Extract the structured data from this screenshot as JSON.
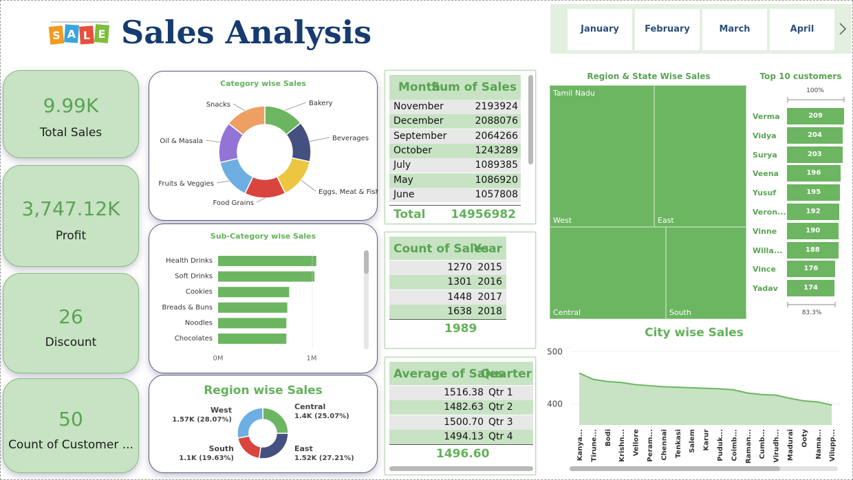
{
  "header": {
    "logo_text": "SALE",
    "title": "Sales Analysis"
  },
  "kpis": [
    {
      "value": "9.99K",
      "label": "Total Sales"
    },
    {
      "value": "3,747.12K",
      "label": "Profit"
    },
    {
      "value": "26",
      "label": "Discount"
    },
    {
      "value": "50",
      "label": "Count of Customer ..."
    }
  ],
  "category_chart": {
    "title": "Category wise Sales",
    "slices": [
      {
        "name": "Bakery",
        "color": "#6cb561"
      },
      {
        "name": "Beverages",
        "color": "#44507f"
      },
      {
        "name": "Eggs, Meat & Fish",
        "color": "#edc641"
      },
      {
        "name": "Food Grains",
        "color": "#d9443e"
      },
      {
        "name": "Fruits & Veggies",
        "color": "#6daee3"
      },
      {
        "name": "Oil & Masala",
        "color": "#9374d6"
      },
      {
        "name": "Snacks",
        "color": "#ee9f62"
      }
    ]
  },
  "subcategory_chart": {
    "title": "Sub-Category wise Sales",
    "categories": [
      "Health Drinks",
      "Soft Drinks",
      "Cookies",
      "Breads & Buns",
      "Noodles",
      "Chocolates"
    ],
    "tick_labels": [
      "0M",
      "1M"
    ],
    "bar_color": "#6cb561"
  },
  "region_chart": {
    "title": "Region wise Sales",
    "slices": [
      {
        "name": "Central",
        "label": "1.4K (25.07%)",
        "color": "#6cb561"
      },
      {
        "name": "East",
        "label": "1.52K (27.21%)",
        "color": "#44507f"
      },
      {
        "name": "South",
        "label": "1.1K (19.63%)",
        "color": "#d9443e"
      },
      {
        "name": "West",
        "label": "1.57K (28.07%)",
        "color": "#6daee3"
      }
    ]
  },
  "month_table": {
    "headers": [
      "Month",
      "Sum of Sales"
    ],
    "rows": [
      [
        "November",
        "2193924"
      ],
      [
        "December",
        "2088076"
      ],
      [
        "September",
        "2064266"
      ],
      [
        "October",
        "1243289"
      ],
      [
        "July",
        "1089385"
      ],
      [
        "May",
        "1086920"
      ],
      [
        "June",
        "1057808"
      ]
    ],
    "total_label": "Total",
    "total_value": "14956982"
  },
  "year_table": {
    "headers": [
      "Count of Sales",
      "Year"
    ],
    "rows": [
      [
        "1270",
        "2015"
      ],
      [
        "1301",
        "2016"
      ],
      [
        "1448",
        "2017"
      ],
      [
        "1638",
        "2018"
      ]
    ],
    "total_value": "1989"
  },
  "quarter_table": {
    "headers": [
      "Average of Sales",
      "Quarter"
    ],
    "rows": [
      [
        "1516.38",
        "Qtr 1"
      ],
      [
        "1482.63",
        "Qtr 2"
      ],
      [
        "1500.70",
        "Qtr 3"
      ],
      [
        "1494.13",
        "Qtr 4"
      ]
    ],
    "total_value": "1496.60"
  },
  "month_slicer": {
    "items": [
      "January",
      "February",
      "March",
      "April"
    ],
    "next_icon": "chevron-right-icon"
  },
  "treemap": {
    "title": "Region & State Wise Sales",
    "state_label": "Tamil Nadu",
    "regions": [
      "West",
      "East",
      "Central",
      "South"
    ],
    "color": "#6cb561"
  },
  "top_customers": {
    "title": "Top 10 customers",
    "top_percent": "100%",
    "bottom_percent": "83.3%",
    "customers": [
      {
        "name": "Verma",
        "value": 209
      },
      {
        "name": "Vidya",
        "value": 204
      },
      {
        "name": "Surya",
        "value": 203
      },
      {
        "name": "Veena",
        "value": 196
      },
      {
        "name": "Yusuf",
        "value": 195
      },
      {
        "name": "Veron...",
        "value": 192
      },
      {
        "name": "Vinne",
        "value": 190
      },
      {
        "name": "Willa...",
        "value": 188
      },
      {
        "name": "Vince",
        "value": 176
      },
      {
        "name": "Yadav",
        "value": 174
      }
    ]
  },
  "city_chart": {
    "title": "City wise Sales",
    "y_ticks": [
      "500",
      "400"
    ]
  },
  "chart_data": [
    {
      "type": "pie",
      "title": "Category wise Sales",
      "categories": [
        "Bakery",
        "Beverages",
        "Eggs, Meat & Fish",
        "Food Grains",
        "Fruits & Veggies",
        "Oil & Masala",
        "Snacks"
      ],
      "values": [
        14.2,
        14.2,
        14.3,
        14.4,
        14.2,
        14.3,
        14.4
      ]
    },
    {
      "type": "bar",
      "orientation": "horizontal",
      "title": "Sub-Category wise Sales",
      "categories": [
        "Health Drinks",
        "Soft Drinks",
        "Cookies",
        "Breads & Buns",
        "Noodles",
        "Chocolates"
      ],
      "values": [
        1.05,
        1.03,
        0.76,
        0.74,
        0.73,
        0.73
      ],
      "xlim": [
        0,
        1.25
      ],
      "x_ticks": [
        "0M",
        "1M"
      ]
    },
    {
      "type": "pie",
      "title": "Region wise Sales",
      "categories": [
        "Central",
        "East",
        "South",
        "West"
      ],
      "values": [
        25.07,
        27.21,
        19.63,
        28.07
      ]
    },
    {
      "type": "bar",
      "title": "Top 10 customers",
      "categories": [
        "Verma",
        "Vidya",
        "Surya",
        "Veena",
        "Yusuf",
        "Veron...",
        "Vinne",
        "Willa...",
        "Vince",
        "Yadav"
      ],
      "values": [
        209,
        204,
        203,
        196,
        195,
        192,
        190,
        188,
        176,
        174
      ]
    },
    {
      "type": "area",
      "title": "City wise Sales",
      "x": [
        "Kanya...",
        "Tirune...",
        "Bodi",
        "Krishn...",
        "Vellore",
        "Peram...",
        "Chennai",
        "Tenkasi",
        "Salem",
        "Karur",
        "Puduk...",
        "Coimb...",
        "Raman...",
        "Cumb...",
        "Virudh...",
        "Madurai",
        "Ooty",
        "Nama...",
        "Vilupp..."
      ],
      "values": [
        459,
        447,
        443,
        441,
        437,
        435,
        433,
        432,
        431,
        430,
        429,
        427,
        421,
        418,
        417,
        411,
        406,
        404,
        398
      ],
      "ylim": [
        360,
        520
      ],
      "y_ticks": [
        500,
        400
      ]
    }
  ]
}
